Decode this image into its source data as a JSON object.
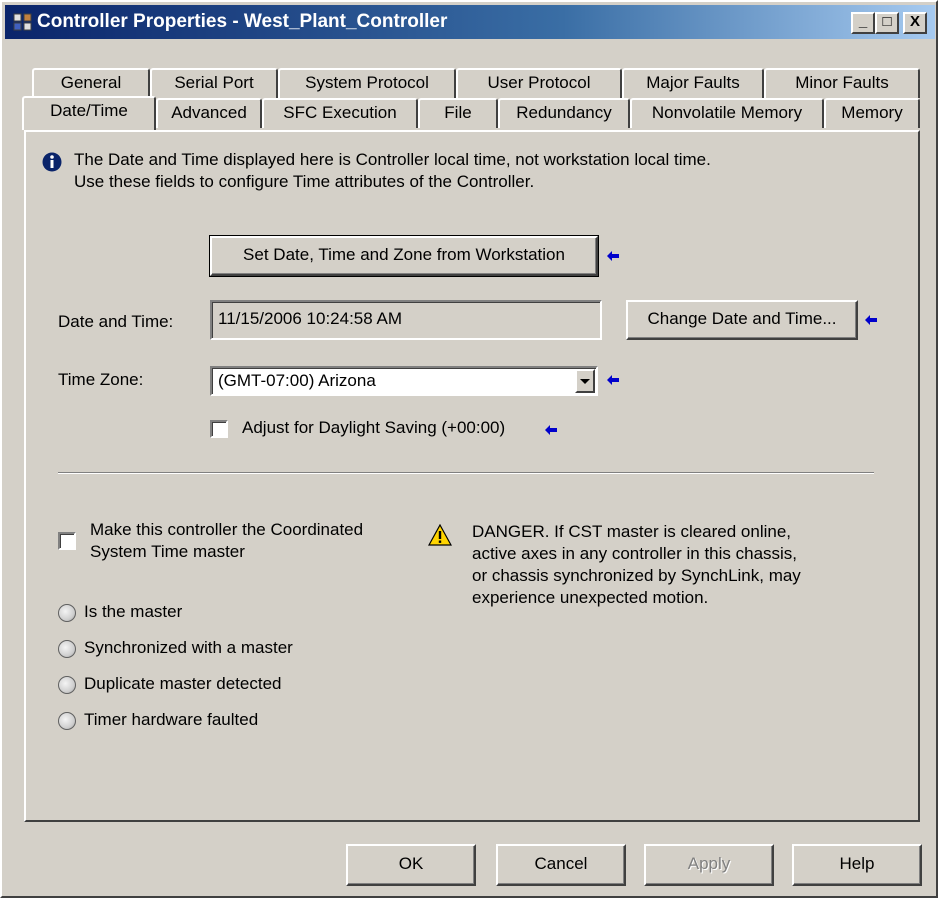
{
  "window": {
    "title": "Controller Properties - West_Plant_Controller",
    "minimize_label": "_",
    "maximize_label": "□",
    "close_label": "X"
  },
  "tabs_back": [
    "General",
    "Serial Port",
    "System Protocol",
    "User Protocol",
    "Major Faults",
    "Minor Faults"
  ],
  "tabs_front": [
    "Date/Time",
    "Advanced",
    "SFC Execution",
    "File",
    "Redundancy",
    "Nonvolatile Memory",
    "Memory"
  ],
  "active_tab": "Date/Time",
  "info": {
    "line1": "The Date and Time displayed here is Controller local time, not workstation local time.",
    "line2": "Use these fields to configure Time attributes of the Controller."
  },
  "set_from_workstation_button": "Set Date, Time and Zone from Workstation",
  "date_time": {
    "label": "Date and Time:",
    "value": "11/15/2006 10:24:58 AM",
    "change_button": "Change Date and Time..."
  },
  "time_zone": {
    "label": "Time Zone:",
    "value": "(GMT-07:00) Arizona"
  },
  "daylight_saving": {
    "label": "Adjust for Daylight Saving (+00:00)",
    "checked": false
  },
  "cst_master": {
    "line1": "Make this controller the Coordinated",
    "line2": "System Time master",
    "checked": false
  },
  "danger": {
    "line1": "DANGER. If CST master is cleared online,",
    "line2": "active axes in any controller in this chassis,",
    "line3": "or chassis synchronized by SynchLink, may",
    "line4": "experience unexpected motion."
  },
  "status_indicators": [
    "Is the master",
    "Synchronized with a master",
    "Duplicate master detected",
    "Timer hardware faulted"
  ],
  "buttons": {
    "ok": "OK",
    "cancel": "Cancel",
    "apply": "Apply",
    "help": "Help"
  },
  "colors": {
    "title_gradient_start": "#0a246a",
    "dialog_face": "#d4d0c8",
    "info_icon": "#0a246a",
    "warning_icon": "#ffd400",
    "pointer_arrow": "#0000cc"
  }
}
